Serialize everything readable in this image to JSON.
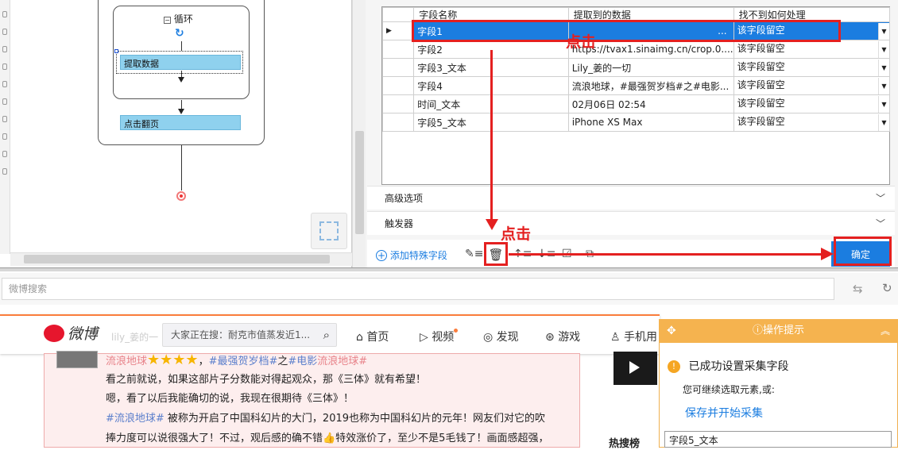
{
  "workflow": {
    "loop_label": "循环",
    "extract_node": "提取数据",
    "next_page_node": "点击翻页"
  },
  "fields": {
    "headers": [
      "字段名称",
      "提取到的数据",
      "找不到如何处理"
    ],
    "rows": [
      {
        "name": "字段1",
        "data": "...",
        "handling": "该字段留空",
        "selected": true
      },
      {
        "name": "字段2",
        "data": "https://tvax1.sinaimg.cn/crop.0....",
        "handling": "该字段留空"
      },
      {
        "name": "字段3_文本",
        "data": "Lily_姜的一切",
        "handling": "该字段留空"
      },
      {
        "name": "字段4",
        "data": "流浪地球，#最强贺岁档#之#电影...",
        "handling": "该字段留空"
      },
      {
        "name": "时间_文本",
        "data": "02月06日 02:54",
        "handling": "该字段留空"
      },
      {
        "name": "字段5_文本",
        "data": "iPhone XS Max",
        "handling": "该字段留空"
      }
    ],
    "advanced": "高级选项",
    "trigger": "触发器",
    "add_special": "添加特殊字段",
    "confirm": "确定"
  },
  "annotations": {
    "click1": "点击",
    "click2": "点击"
  },
  "browser": {
    "search_placeholder": "微博搜索"
  },
  "weibo": {
    "logo": "微博",
    "search_hint": "大家正在搜：耐克市值蒸发近1...",
    "nav": [
      "首页",
      "视频",
      "发现",
      "游戏",
      "手机用"
    ],
    "username": "lily_姜的一",
    "post": {
      "line1_tag1": "流浪地球",
      "line1_tag2": "#最强贺岁档#",
      "line1_mid": "之",
      "line1_tag3": "#电影",
      "line1_tag4": "流浪地球#",
      "line2": "看之前就说，如果这部片子分数能对得起观众，那《三体》就有希望！",
      "line3": "嗯，看了以后我能确切的说，我现在很期待《三体》！",
      "line4_tag": "#流浪地球#",
      "line4": " 被称为开启了中国科幻片的大门，2019也称为中国科幻片的元年！网友们对它的吹",
      "line5": "捧力度可以说很强大了！不过，观后感的确不错👍特效涨价了，至少不是5毛钱了！画面感超强，"
    },
    "hot": "热搜榜"
  },
  "tips": {
    "title": "操作提示",
    "success": "已成功设置采集字段",
    "continue": "您可继续选取元素,或:",
    "save_start": "保存并开始采集",
    "field_preview": "字段5_文本"
  },
  "colors": {
    "accent_blue": "#1b7de0",
    "node_blue": "#8fd1ee",
    "annotation_red": "#e42020",
    "weibo_orange": "#fa7d3c",
    "tips_orange": "#f5b34f"
  }
}
